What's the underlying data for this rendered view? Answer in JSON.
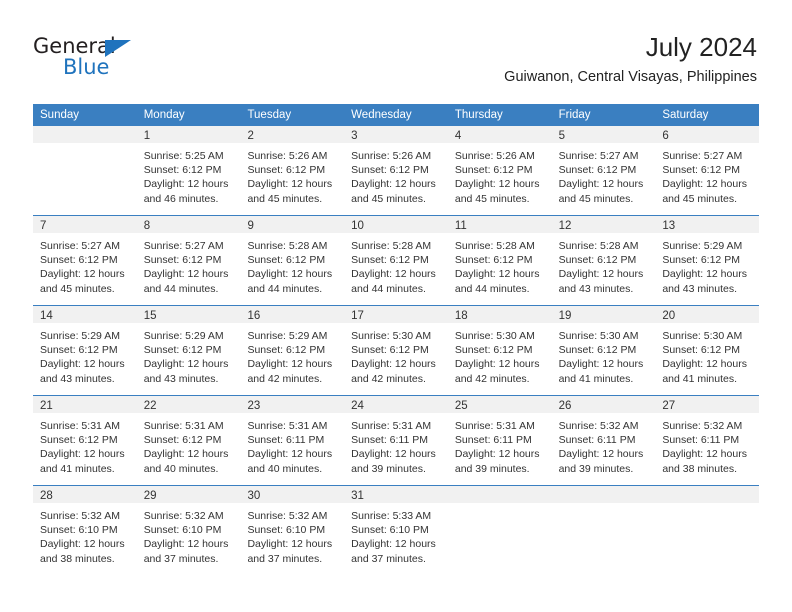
{
  "brand": {
    "name_dark": "General",
    "name_blue": "Blue",
    "accent_color": "#1f73bd"
  },
  "header": {
    "title": "July 2024",
    "subtitle": "Guiwanon, Central Visayas, Philippines"
  },
  "calendar": {
    "header_bg": "#3a7fc1",
    "day_band_bg": "#f1f1f1",
    "weekdays": [
      "Sunday",
      "Monday",
      "Tuesday",
      "Wednesday",
      "Thursday",
      "Friday",
      "Saturday"
    ],
    "weeks": [
      [
        {
          "day": "",
          "empty": true,
          "sunrise": "",
          "sunset": "",
          "daylight1": "",
          "daylight2": ""
        },
        {
          "day": "1",
          "empty": false,
          "sunrise": "Sunrise: 5:25 AM",
          "sunset": "Sunset: 6:12 PM",
          "daylight1": "Daylight: 12 hours",
          "daylight2": "and 46 minutes."
        },
        {
          "day": "2",
          "empty": false,
          "sunrise": "Sunrise: 5:26 AM",
          "sunset": "Sunset: 6:12 PM",
          "daylight1": "Daylight: 12 hours",
          "daylight2": "and 45 minutes."
        },
        {
          "day": "3",
          "empty": false,
          "sunrise": "Sunrise: 5:26 AM",
          "sunset": "Sunset: 6:12 PM",
          "daylight1": "Daylight: 12 hours",
          "daylight2": "and 45 minutes."
        },
        {
          "day": "4",
          "empty": false,
          "sunrise": "Sunrise: 5:26 AM",
          "sunset": "Sunset: 6:12 PM",
          "daylight1": "Daylight: 12 hours",
          "daylight2": "and 45 minutes."
        },
        {
          "day": "5",
          "empty": false,
          "sunrise": "Sunrise: 5:27 AM",
          "sunset": "Sunset: 6:12 PM",
          "daylight1": "Daylight: 12 hours",
          "daylight2": "and 45 minutes."
        },
        {
          "day": "6",
          "empty": false,
          "sunrise": "Sunrise: 5:27 AM",
          "sunset": "Sunset: 6:12 PM",
          "daylight1": "Daylight: 12 hours",
          "daylight2": "and 45 minutes."
        }
      ],
      [
        {
          "day": "7",
          "empty": false,
          "sunrise": "Sunrise: 5:27 AM",
          "sunset": "Sunset: 6:12 PM",
          "daylight1": "Daylight: 12 hours",
          "daylight2": "and 45 minutes."
        },
        {
          "day": "8",
          "empty": false,
          "sunrise": "Sunrise: 5:27 AM",
          "sunset": "Sunset: 6:12 PM",
          "daylight1": "Daylight: 12 hours",
          "daylight2": "and 44 minutes."
        },
        {
          "day": "9",
          "empty": false,
          "sunrise": "Sunrise: 5:28 AM",
          "sunset": "Sunset: 6:12 PM",
          "daylight1": "Daylight: 12 hours",
          "daylight2": "and 44 minutes."
        },
        {
          "day": "10",
          "empty": false,
          "sunrise": "Sunrise: 5:28 AM",
          "sunset": "Sunset: 6:12 PM",
          "daylight1": "Daylight: 12 hours",
          "daylight2": "and 44 minutes."
        },
        {
          "day": "11",
          "empty": false,
          "sunrise": "Sunrise: 5:28 AM",
          "sunset": "Sunset: 6:12 PM",
          "daylight1": "Daylight: 12 hours",
          "daylight2": "and 44 minutes."
        },
        {
          "day": "12",
          "empty": false,
          "sunrise": "Sunrise: 5:28 AM",
          "sunset": "Sunset: 6:12 PM",
          "daylight1": "Daylight: 12 hours",
          "daylight2": "and 43 minutes."
        },
        {
          "day": "13",
          "empty": false,
          "sunrise": "Sunrise: 5:29 AM",
          "sunset": "Sunset: 6:12 PM",
          "daylight1": "Daylight: 12 hours",
          "daylight2": "and 43 minutes."
        }
      ],
      [
        {
          "day": "14",
          "empty": false,
          "sunrise": "Sunrise: 5:29 AM",
          "sunset": "Sunset: 6:12 PM",
          "daylight1": "Daylight: 12 hours",
          "daylight2": "and 43 minutes."
        },
        {
          "day": "15",
          "empty": false,
          "sunrise": "Sunrise: 5:29 AM",
          "sunset": "Sunset: 6:12 PM",
          "daylight1": "Daylight: 12 hours",
          "daylight2": "and 43 minutes."
        },
        {
          "day": "16",
          "empty": false,
          "sunrise": "Sunrise: 5:29 AM",
          "sunset": "Sunset: 6:12 PM",
          "daylight1": "Daylight: 12 hours",
          "daylight2": "and 42 minutes."
        },
        {
          "day": "17",
          "empty": false,
          "sunrise": "Sunrise: 5:30 AM",
          "sunset": "Sunset: 6:12 PM",
          "daylight1": "Daylight: 12 hours",
          "daylight2": "and 42 minutes."
        },
        {
          "day": "18",
          "empty": false,
          "sunrise": "Sunrise: 5:30 AM",
          "sunset": "Sunset: 6:12 PM",
          "daylight1": "Daylight: 12 hours",
          "daylight2": "and 42 minutes."
        },
        {
          "day": "19",
          "empty": false,
          "sunrise": "Sunrise: 5:30 AM",
          "sunset": "Sunset: 6:12 PM",
          "daylight1": "Daylight: 12 hours",
          "daylight2": "and 41 minutes."
        },
        {
          "day": "20",
          "empty": false,
          "sunrise": "Sunrise: 5:30 AM",
          "sunset": "Sunset: 6:12 PM",
          "daylight1": "Daylight: 12 hours",
          "daylight2": "and 41 minutes."
        }
      ],
      [
        {
          "day": "21",
          "empty": false,
          "sunrise": "Sunrise: 5:31 AM",
          "sunset": "Sunset: 6:12 PM",
          "daylight1": "Daylight: 12 hours",
          "daylight2": "and 41 minutes."
        },
        {
          "day": "22",
          "empty": false,
          "sunrise": "Sunrise: 5:31 AM",
          "sunset": "Sunset: 6:12 PM",
          "daylight1": "Daylight: 12 hours",
          "daylight2": "and 40 minutes."
        },
        {
          "day": "23",
          "empty": false,
          "sunrise": "Sunrise: 5:31 AM",
          "sunset": "Sunset: 6:11 PM",
          "daylight1": "Daylight: 12 hours",
          "daylight2": "and 40 minutes."
        },
        {
          "day": "24",
          "empty": false,
          "sunrise": "Sunrise: 5:31 AM",
          "sunset": "Sunset: 6:11 PM",
          "daylight1": "Daylight: 12 hours",
          "daylight2": "and 39 minutes."
        },
        {
          "day": "25",
          "empty": false,
          "sunrise": "Sunrise: 5:31 AM",
          "sunset": "Sunset: 6:11 PM",
          "daylight1": "Daylight: 12 hours",
          "daylight2": "and 39 minutes."
        },
        {
          "day": "26",
          "empty": false,
          "sunrise": "Sunrise: 5:32 AM",
          "sunset": "Sunset: 6:11 PM",
          "daylight1": "Daylight: 12 hours",
          "daylight2": "and 39 minutes."
        },
        {
          "day": "27",
          "empty": false,
          "sunrise": "Sunrise: 5:32 AM",
          "sunset": "Sunset: 6:11 PM",
          "daylight1": "Daylight: 12 hours",
          "daylight2": "and 38 minutes."
        }
      ],
      [
        {
          "day": "28",
          "empty": false,
          "sunrise": "Sunrise: 5:32 AM",
          "sunset": "Sunset: 6:10 PM",
          "daylight1": "Daylight: 12 hours",
          "daylight2": "and 38 minutes."
        },
        {
          "day": "29",
          "empty": false,
          "sunrise": "Sunrise: 5:32 AM",
          "sunset": "Sunset: 6:10 PM",
          "daylight1": "Daylight: 12 hours",
          "daylight2": "and 37 minutes."
        },
        {
          "day": "30",
          "empty": false,
          "sunrise": "Sunrise: 5:32 AM",
          "sunset": "Sunset: 6:10 PM",
          "daylight1": "Daylight: 12 hours",
          "daylight2": "and 37 minutes."
        },
        {
          "day": "31",
          "empty": false,
          "sunrise": "Sunrise: 5:33 AM",
          "sunset": "Sunset: 6:10 PM",
          "daylight1": "Daylight: 12 hours",
          "daylight2": "and 37 minutes."
        },
        {
          "day": "",
          "empty": true,
          "sunrise": "",
          "sunset": "",
          "daylight1": "",
          "daylight2": ""
        },
        {
          "day": "",
          "empty": true,
          "sunrise": "",
          "sunset": "",
          "daylight1": "",
          "daylight2": ""
        },
        {
          "day": "",
          "empty": true,
          "sunrise": "",
          "sunset": "",
          "daylight1": "",
          "daylight2": ""
        }
      ]
    ]
  }
}
